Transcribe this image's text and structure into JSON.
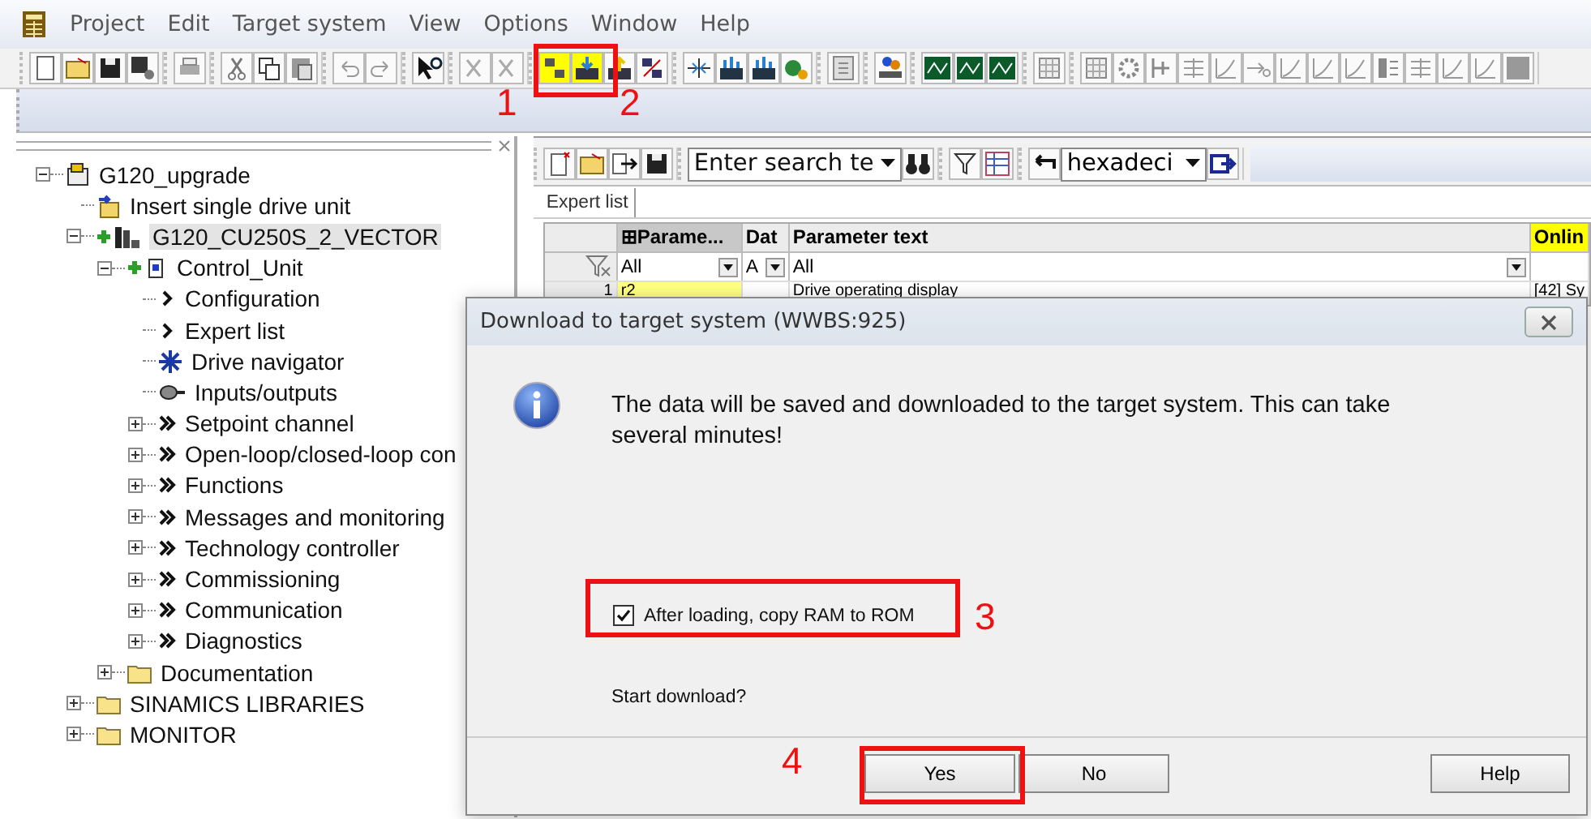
{
  "menu": [
    "Project",
    "Edit",
    "Target system",
    "View",
    "Options",
    "Window",
    "Help"
  ],
  "tree": [
    {
      "label": "G120_upgrade",
      "kind": "project",
      "expanded": true,
      "selected": false,
      "children": [
        {
          "label": "Insert single drive unit",
          "kind": "insert",
          "selected": false
        },
        {
          "label": "G120_CU250S_2_VECTOR",
          "kind": "drive",
          "expanded": true,
          "selected": true,
          "children": [
            {
              "label": "Control_Unit",
              "kind": "unit",
              "expanded": true,
              "selected": false,
              "children": [
                {
                  "label": "Configuration",
                  "kind": "chevron",
                  "selected": false
                },
                {
                  "label": "Expert list",
                  "kind": "chevron",
                  "selected": false
                },
                {
                  "label": "Drive navigator",
                  "kind": "navigator",
                  "selected": false
                },
                {
                  "label": "Inputs/outputs",
                  "kind": "io",
                  "selected": false
                },
                {
                  "label": "Setpoint channel",
                  "kind": "double-chevron",
                  "expanded": false,
                  "selected": false
                },
                {
                  "label": "Open-loop/closed-loop con",
                  "kind": "double-chevron",
                  "expanded": false,
                  "selected": false
                },
                {
                  "label": "Functions",
                  "kind": "double-chevron",
                  "expanded": false,
                  "selected": false
                },
                {
                  "label": "Messages and monitoring",
                  "kind": "double-chevron",
                  "expanded": false,
                  "selected": false
                },
                {
                  "label": "Technology controller",
                  "kind": "double-chevron",
                  "expanded": false,
                  "selected": false
                },
                {
                  "label": "Commissioning",
                  "kind": "double-chevron",
                  "expanded": false,
                  "selected": false
                },
                {
                  "label": "Communication",
                  "kind": "double-chevron",
                  "expanded": false,
                  "selected": false
                },
                {
                  "label": "Diagnostics",
                  "kind": "double-chevron",
                  "expanded": false,
                  "selected": false
                }
              ]
            },
            {
              "label": "Documentation",
              "kind": "folder",
              "expanded": false,
              "selected": false
            }
          ]
        },
        {
          "label": "SINAMICS LIBRARIES",
          "kind": "folder",
          "expanded": false,
          "selected": false
        },
        {
          "label": "MONITOR",
          "kind": "folder",
          "expanded": false,
          "selected": false
        }
      ]
    }
  ],
  "expert_toolbar": {
    "search": {
      "placeholder": "Enter search te"
    },
    "format": "hexadeci"
  },
  "tabs": [
    {
      "label": "Expert list",
      "selected": true
    }
  ],
  "table": {
    "columns": [
      "",
      "⊞Parame...",
      "Dat",
      "Parameter text",
      "Onlin"
    ],
    "filter": [
      "All",
      "A",
      "All"
    ],
    "rows": [
      [
        "1",
        "r2",
        "",
        "Drive operating display",
        "[42] Sy"
      ]
    ]
  },
  "dialog": {
    "title": "Download to target system (WWBS:925)",
    "message": "The data will be saved and downloaded to the target system. This can take several minutes!",
    "checkbox": {
      "label": "After loading, copy RAM to ROM",
      "checked": true
    },
    "question": "Start download?",
    "buttons": [
      "Yes",
      "No",
      "Help"
    ]
  },
  "annotations": [
    "1",
    "2",
    "3",
    "4"
  ]
}
